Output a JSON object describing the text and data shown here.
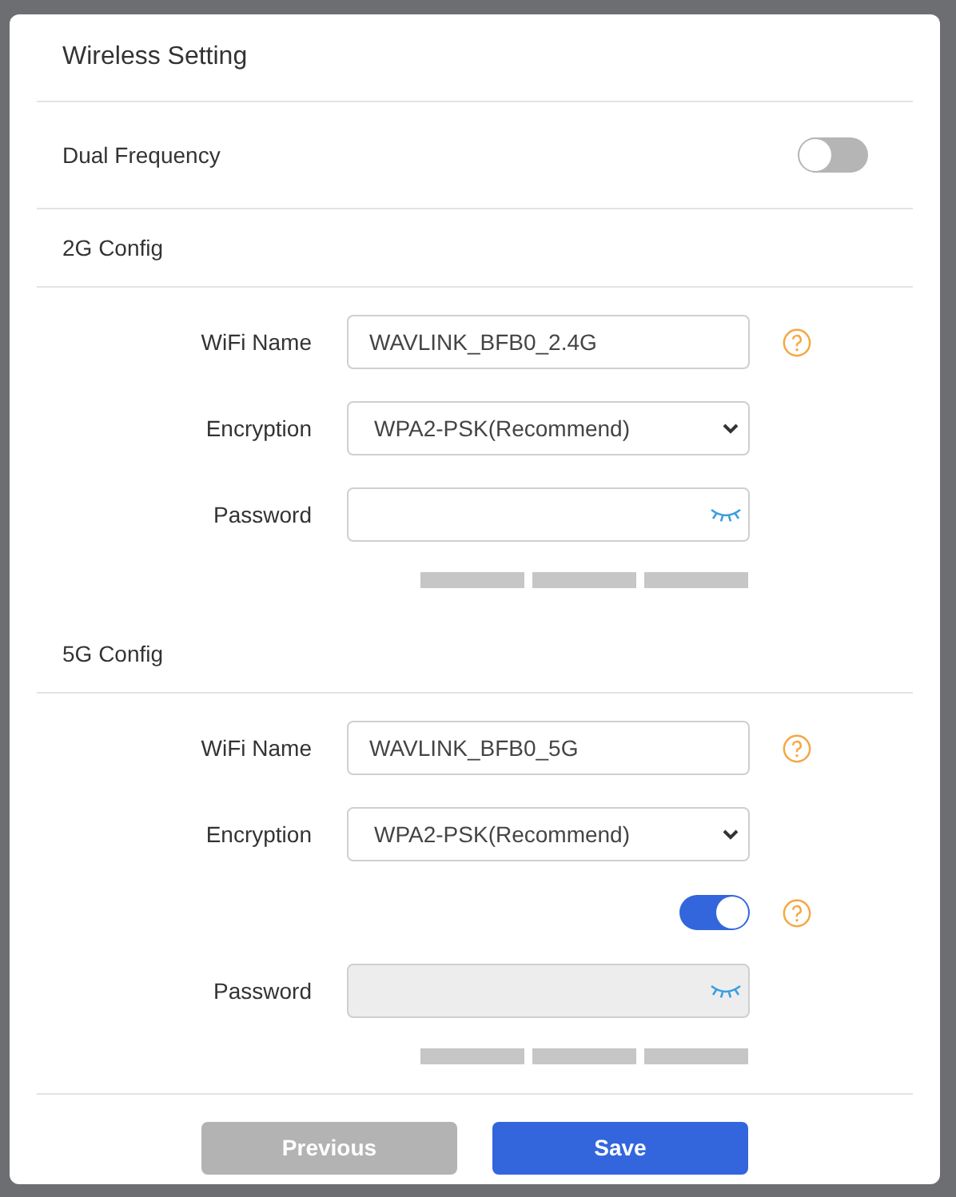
{
  "dialog": {
    "title": "Wireless Setting"
  },
  "dual_frequency": {
    "label": "Dual Frequency",
    "on": false
  },
  "sections": [
    {
      "title": "2G Config",
      "fields": [
        {
          "kind": "text",
          "label": "WiFi Name",
          "value": "WAVLINK_BFB0_2.4G",
          "help": true
        },
        {
          "kind": "select",
          "label": "Encryption",
          "value": "WPA2-PSK(Recommend)"
        },
        {
          "kind": "password",
          "label": "Password",
          "disabled": false
        },
        {
          "kind": "strength"
        }
      ]
    },
    {
      "title": "5G Config",
      "fields": [
        {
          "kind": "text",
          "label": "WiFi Name",
          "value": "WAVLINK_BFB0_5G",
          "help": true
        },
        {
          "kind": "select",
          "label": "Encryption",
          "value": "WPA2-PSK(Recommend)"
        },
        {
          "kind": "toggle",
          "on": true,
          "help": true
        },
        {
          "kind": "password",
          "label": "Password",
          "disabled": true
        },
        {
          "kind": "strength"
        }
      ]
    }
  ],
  "buttons": [
    {
      "label": "Previous",
      "disabled": true
    },
    {
      "label": "Save",
      "disabled": false
    }
  ]
}
